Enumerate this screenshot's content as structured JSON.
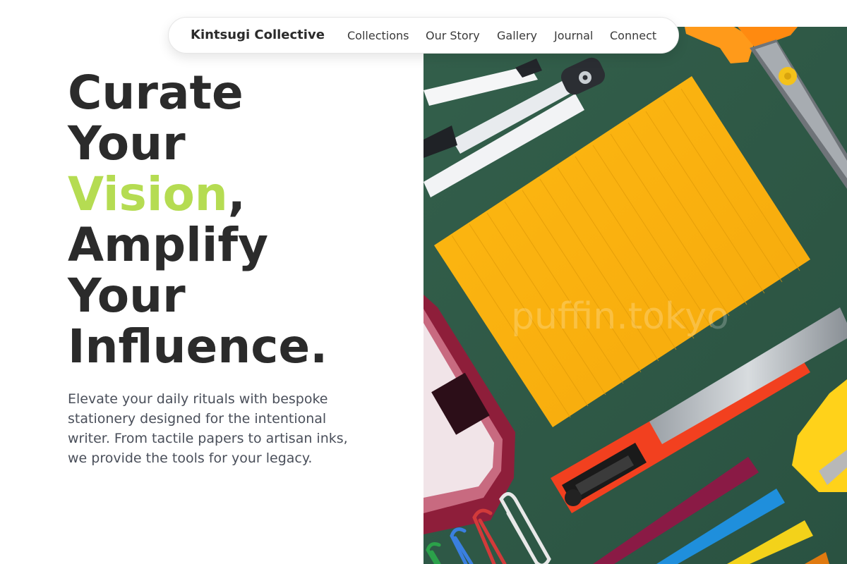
{
  "nav": {
    "brand": "Kintsugi Collective",
    "links": [
      "Collections",
      "Our Story",
      "Gallery",
      "Journal",
      "Connect"
    ]
  },
  "hero": {
    "headline": {
      "line1": "Curate",
      "line2": "Your",
      "line3_accent": "Vision",
      "line3_rest": ",",
      "line4": "Amplify",
      "line5": "Your",
      "line6": "Influence."
    },
    "lede": "Elevate your daily rituals with bespoke stationery designed for the intentional writer. From tactile papers to artisan inks, we provide the tools for your legacy.",
    "image": {
      "subject": "stationery flat lay on green background",
      "watermark": "puffin.tokyo"
    }
  },
  "colors": {
    "accent": "#b5dc52",
    "text": "#2b2b2b",
    "body": "#4a4f5a",
    "board": "#2f5a45",
    "note": "#fbb714",
    "cutter": "#f2401f"
  }
}
